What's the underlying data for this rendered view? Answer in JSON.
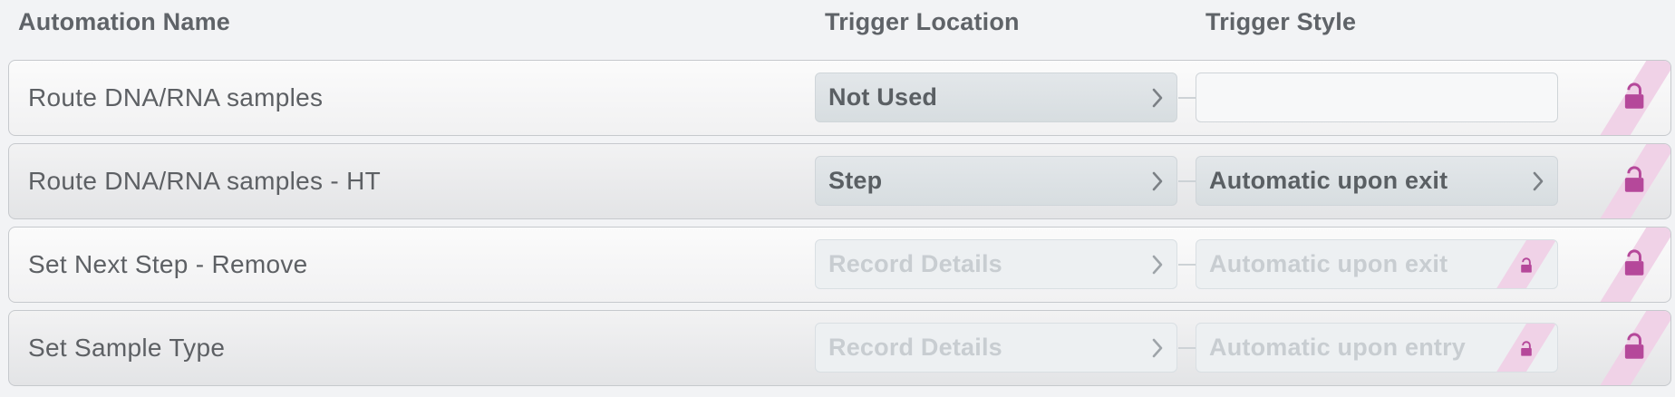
{
  "headers": {
    "name": "Automation Name",
    "location": "Trigger Location",
    "style": "Trigger Style"
  },
  "colors": {
    "lock": "#b5489a",
    "lock_stripe": "#f0d2e7"
  },
  "rows": [
    {
      "name": "Route DNA/RNA samples",
      "location": "Not Used",
      "location_state": "active",
      "style": "",
      "style_state": "empty",
      "style_locked": false,
      "row_locked": true
    },
    {
      "name": "Route DNA/RNA samples - HT",
      "location": "Step",
      "location_state": "active",
      "style": "Automatic upon exit",
      "style_state": "active",
      "style_locked": false,
      "row_locked": true
    },
    {
      "name": "Set Next Step - Remove",
      "location": "Record Details",
      "location_state": "disabled",
      "style": "Automatic upon exit",
      "style_state": "disabled",
      "style_locked": true,
      "row_locked": true
    },
    {
      "name": "Set Sample Type",
      "location": "Record Details",
      "location_state": "disabled",
      "style": "Automatic upon entry",
      "style_state": "disabled",
      "style_locked": true,
      "row_locked": true
    }
  ],
  "icons": {
    "chevron": "chevron-right-icon",
    "lock": "lock-icon"
  }
}
